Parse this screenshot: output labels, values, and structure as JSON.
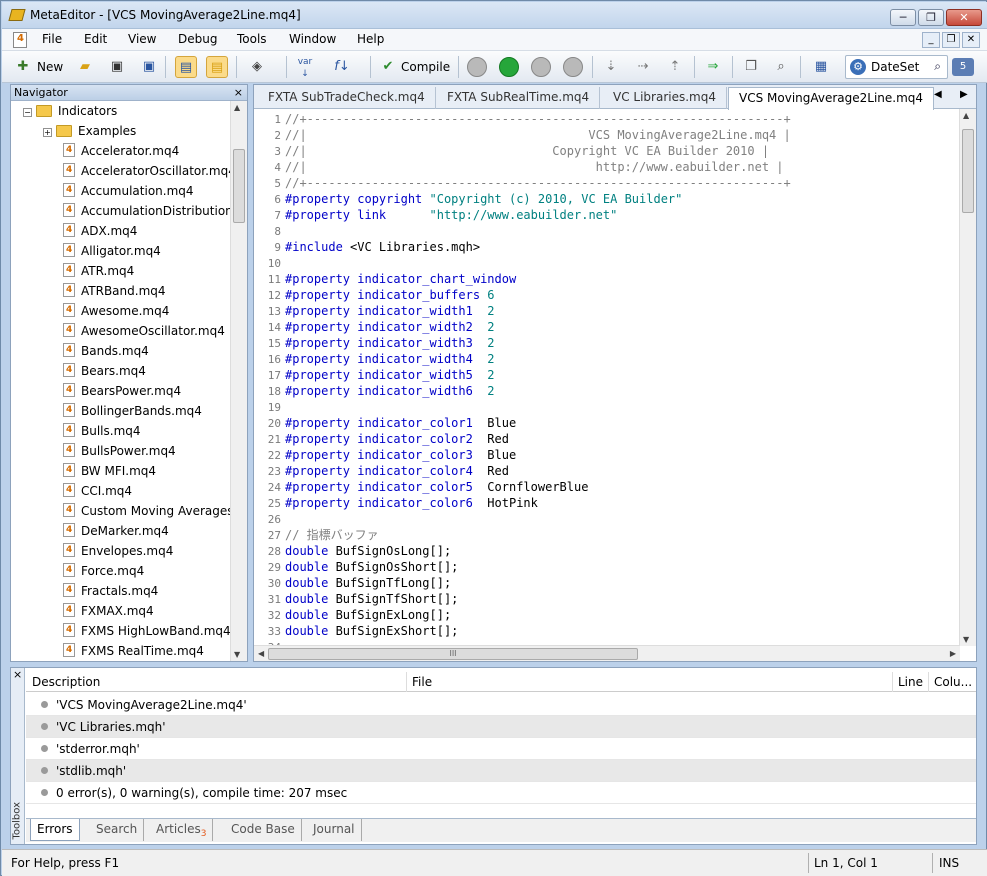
{
  "window": {
    "title": "MetaEditor - [VCS MovingAverage2Line.mq4]",
    "minimize": "─",
    "restore": "❐",
    "close": "✕"
  },
  "menubar": {
    "items": [
      "File",
      "Edit",
      "View",
      "Debug",
      "Tools",
      "Window",
      "Help"
    ],
    "mdi": {
      "minimize": "_",
      "restore": "❐",
      "close": "✕"
    }
  },
  "toolbar": {
    "new_label": "New",
    "compile_label": "Compile",
    "var_label": "var",
    "f_label": "f",
    "search_value": "DateSet",
    "notify_count": "5"
  },
  "navigator": {
    "title": "Navigator",
    "close": "×",
    "root": "Indicators",
    "root_expander": "−",
    "folder": "Examples",
    "folder_expander": "+",
    "files": [
      "Accelerator.mq4",
      "AcceleratorOscillator.mq4",
      "Accumulation.mq4",
      "AccumulationDistribution.",
      "ADX.mq4",
      "Alligator.mq4",
      "ATR.mq4",
      "ATRBand.mq4",
      "Awesome.mq4",
      "AwesomeOscillator.mq4",
      "Bands.mq4",
      "Bears.mq4",
      "BearsPower.mq4",
      "BollingerBands.mq4",
      "Bulls.mq4",
      "BullsPower.mq4",
      "BW MFI.mq4",
      "CCI.mq4",
      "Custom Moving Averages",
      "DeMarker.mq4",
      "Envelopes.mq4",
      "Force.mq4",
      "Fractals.mq4",
      "FXMAX.mq4",
      "FXMS HighLowBand.mq4",
      "FXMS RealTime.mq4"
    ]
  },
  "editor": {
    "tabs": [
      "FXTA SubTradeCheck.mq4",
      "FXTA SubRealTime.mq4",
      "VC Libraries.mq4",
      "VCS MovingAverage2Line.mq4"
    ],
    "active_tab": 3,
    "tab_prev": "◀",
    "tab_next": "▶",
    "hscroll_grip": "III",
    "lines": [
      [
        [
          "c-comment",
          "//+------------------------------------------------------------------+"
        ]
      ],
      [
        [
          "c-comment",
          "//|                                       VCS MovingAverage2Line.mq4 |"
        ]
      ],
      [
        [
          "c-comment",
          "//|                                  Copyright VC EA Builder 2010 |"
        ]
      ],
      [
        [
          "c-comment",
          "//|                                        http://www.eabuilder.net |"
        ]
      ],
      [
        [
          "c-comment",
          "//+------------------------------------------------------------------+"
        ]
      ],
      [
        [
          "c-kw",
          "#property copyright "
        ],
        [
          "c-str",
          "\"Copyright (c) 2010, VC EA Builder\""
        ]
      ],
      [
        [
          "c-kw",
          "#property link      "
        ],
        [
          "c-str",
          "\"http://www.eabuilder.net\""
        ]
      ],
      [],
      [
        [
          "c-kw",
          "#include "
        ],
        [
          "c-plain",
          "<VC Libraries.mqh>"
        ]
      ],
      [],
      [
        [
          "c-kw",
          "#property indicator_chart_window"
        ]
      ],
      [
        [
          "c-kw",
          "#property indicator_buffers "
        ],
        [
          "c-num",
          "6"
        ]
      ],
      [
        [
          "c-kw",
          "#property indicator_width1  "
        ],
        [
          "c-num",
          "2"
        ]
      ],
      [
        [
          "c-kw",
          "#property indicator_width2  "
        ],
        [
          "c-num",
          "2"
        ]
      ],
      [
        [
          "c-kw",
          "#property indicator_width3  "
        ],
        [
          "c-num",
          "2"
        ]
      ],
      [
        [
          "c-kw",
          "#property indicator_width4  "
        ],
        [
          "c-num",
          "2"
        ]
      ],
      [
        [
          "c-kw",
          "#property indicator_width5  "
        ],
        [
          "c-num",
          "2"
        ]
      ],
      [
        [
          "c-kw",
          "#property indicator_width6  "
        ],
        [
          "c-num",
          "2"
        ]
      ],
      [],
      [
        [
          "c-kw",
          "#property indicator_color1  "
        ],
        [
          "c-plain",
          "Blue"
        ]
      ],
      [
        [
          "c-kw",
          "#property indicator_color2  "
        ],
        [
          "c-plain",
          "Red"
        ]
      ],
      [
        [
          "c-kw",
          "#property indicator_color3  "
        ],
        [
          "c-plain",
          "Blue"
        ]
      ],
      [
        [
          "c-kw",
          "#property indicator_color4  "
        ],
        [
          "c-plain",
          "Red"
        ]
      ],
      [
        [
          "c-kw",
          "#property indicator_color5  "
        ],
        [
          "c-plain",
          "CornflowerBlue"
        ]
      ],
      [
        [
          "c-kw",
          "#property indicator_color6  "
        ],
        [
          "c-plain",
          "HotPink"
        ]
      ],
      [],
      [
        [
          "c-comment",
          "// 指標バッファ"
        ]
      ],
      [
        [
          "c-kw",
          "double "
        ],
        [
          "c-plain",
          "BufSignOsLong[];"
        ]
      ],
      [
        [
          "c-kw",
          "double "
        ],
        [
          "c-plain",
          "BufSignOsShort[];"
        ]
      ],
      [
        [
          "c-kw",
          "double "
        ],
        [
          "c-plain",
          "BufSignTfLong[];"
        ]
      ],
      [
        [
          "c-kw",
          "double "
        ],
        [
          "c-plain",
          "BufSignTfShort[];"
        ]
      ],
      [
        [
          "c-kw",
          "double "
        ],
        [
          "c-plain",
          "BufSignExLong[];"
        ]
      ],
      [
        [
          "c-kw",
          "double "
        ],
        [
          "c-plain",
          "BufSignExShort[];"
        ]
      ],
      []
    ]
  },
  "toolbox": {
    "close": "×",
    "side_label": "Toolbox",
    "columns": [
      "Description",
      "File",
      "Line",
      "Colu..."
    ],
    "messages": [
      "'VCS MovingAverage2Line.mq4'",
      "'VC Libraries.mqh'",
      "'stderror.mqh'",
      "'stdlib.mqh'",
      "0 error(s), 0 warning(s), compile time: 207 msec"
    ],
    "tabs": [
      "Errors",
      "Search",
      "Articles",
      "Code Base",
      "Journal"
    ],
    "articles_badge": "3"
  },
  "statusbar": {
    "help": "For Help, press F1",
    "position": "Ln 1, Col 1",
    "mode": "INS"
  }
}
